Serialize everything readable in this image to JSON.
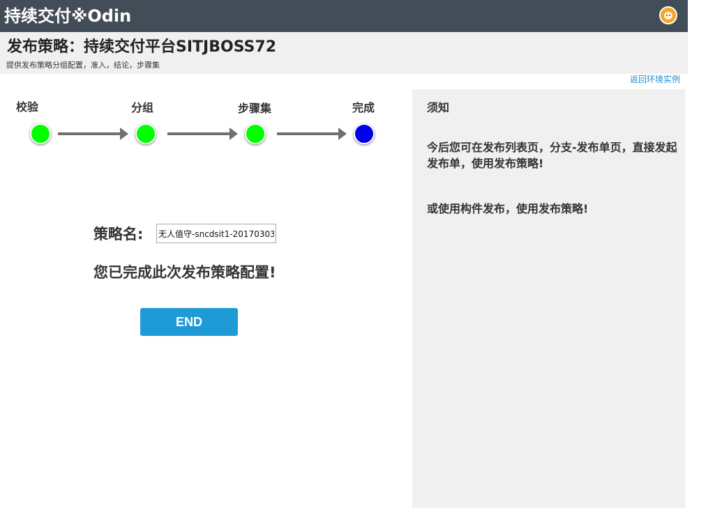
{
  "app": {
    "title": "持续交付※Odin"
  },
  "header": {
    "title": "发布策略：持续交付平台SITJBOSS72",
    "subtitle": "提供发布策略分组配置，准入，结论，步骤集"
  },
  "nav": {
    "back_link": "返回环境实例"
  },
  "steps": [
    {
      "label": "校验",
      "status": "completed",
      "color": "#00ff00"
    },
    {
      "label": "分组",
      "status": "completed",
      "color": "#00ff00"
    },
    {
      "label": "步骤集",
      "status": "completed",
      "color": "#00ff00"
    },
    {
      "label": "完成",
      "status": "current",
      "color": "#0000ee"
    }
  ],
  "form": {
    "strategy_label": "策略名:",
    "strategy_value": "无人值守-sncdsit1-20170303",
    "completion_message": "您已完成此次发布策略配置!",
    "end_button": "END"
  },
  "notice": {
    "title": "须知",
    "paragraphs": [
      "今后您可在发布列表页，分支-发布单页，直接发起发布单，使用发布策略!",
      "或使用构件发布，使用发布策略!"
    ]
  },
  "colors": {
    "topbar": "#434d57",
    "accent": "#1e9ad6",
    "step_done": "#00ff00",
    "step_current": "#0000ee"
  }
}
